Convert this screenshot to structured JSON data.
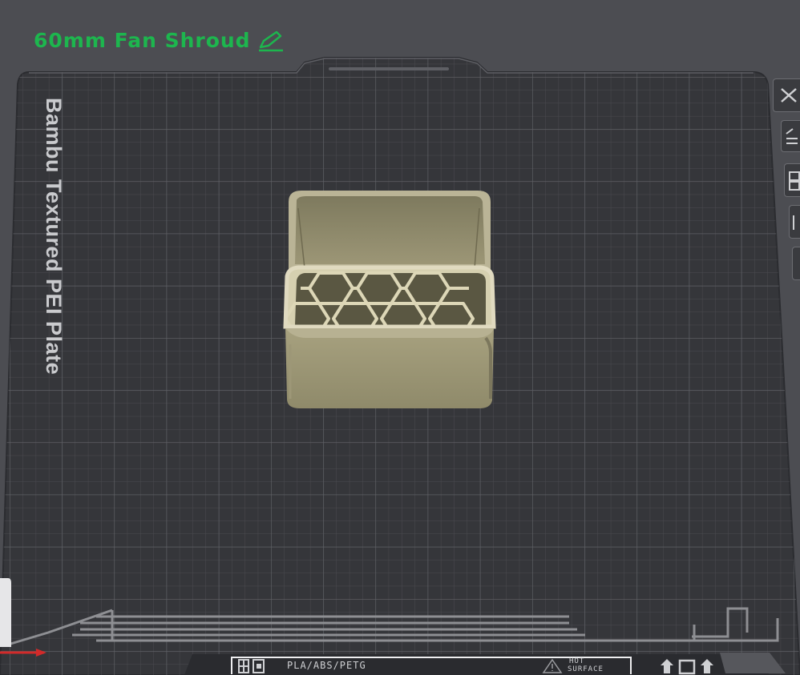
{
  "project": {
    "title": "60mm Fan Shroud"
  },
  "plate": {
    "name": "Bambu Textured PEI Plate",
    "materials": "PLA/ABS/PETG",
    "warning_line1": "HOT",
    "warning_line2": "SURFACE"
  },
  "icons": {
    "edit": "pencil-icon",
    "close": "close-icon",
    "arrange": "arrange-icon",
    "orient": "orient-icon",
    "layers": "layers-icon"
  },
  "colors": {
    "title": "#1db64e",
    "background": "#4c4d52",
    "plate": "#35363a",
    "grid": "#5a5b60",
    "model": "#b3ad8c",
    "model_shadow": "#7c775d"
  }
}
